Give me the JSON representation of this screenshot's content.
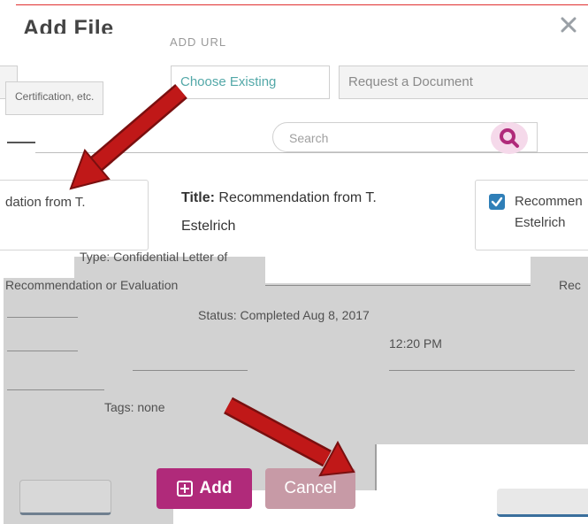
{
  "modal": {
    "title": "Add File",
    "title_noise": "ADD URL"
  },
  "tabs": {
    "left_partial_label": "Certification, etc.",
    "choose_existing": "Choose Existing",
    "request_document": "Request a Document"
  },
  "search": {
    "placeholder": "Search"
  },
  "cards": {
    "left_partial_text": "dation from T.",
    "middle_title_label": "Title:",
    "middle_title_value": "Recommendation from T.",
    "middle_title_value_2": "Estelrich",
    "right_partial_line1": "Recommen",
    "right_partial_line2": "Estelrich",
    "right_checked": true
  },
  "details": {
    "type": "Type: Confidential Letter of",
    "recommendation": "Recommendation or Evaluation",
    "rec_right": "Rec",
    "status": "Status: Completed Aug 8, 2017",
    "time": "12:20 PM",
    "tags": "Tags: none"
  },
  "footer": {
    "add_label": "Add",
    "cancel_label": "Cancel"
  },
  "colors": {
    "accent": "#b02a7a",
    "arrow": "#c01818",
    "checkbox": "#2f7fb8",
    "teal": "#53a8a8"
  },
  "icons": {
    "close": "close-icon",
    "search": "search-icon",
    "check": "check-icon",
    "add": "plus-square-icon"
  }
}
